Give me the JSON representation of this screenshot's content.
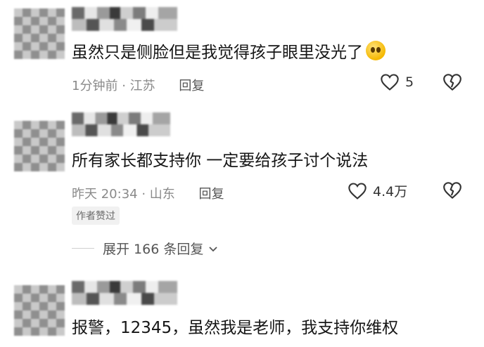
{
  "comments": [
    {
      "text": "虽然只是侧脸但是我觉得孩子眼里没光了",
      "time": "1分钟前",
      "location": "江苏",
      "reply_label": "回复",
      "likes": "5",
      "emoji": "pleading-face"
    },
    {
      "text": "所有家长都支持你  一定要给孩子讨个说法",
      "time": "昨天 20:34",
      "location": "山东",
      "reply_label": "回复",
      "likes": "4.4万",
      "badge": "作者赞过",
      "expand_label": "展开 166 条回复"
    },
    {
      "text": "报警，12345，虽然我是老师，我支持你维权"
    }
  ],
  "colors": {
    "text": "#161616",
    "meta": "#8a8a8a",
    "background": "#ffffff"
  }
}
